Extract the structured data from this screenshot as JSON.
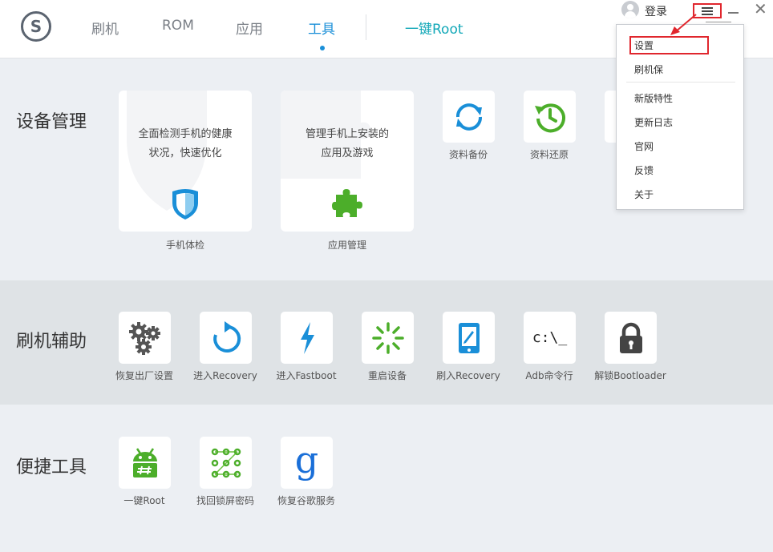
{
  "header": {
    "logo_letter": "S",
    "tabs": [
      {
        "label": "刷机"
      },
      {
        "label": "ROM"
      },
      {
        "label": "应用"
      },
      {
        "label": "工具"
      }
    ],
    "active_tab": "工具",
    "root_link": "一键Root",
    "login": "登录",
    "close_glyph": "✕"
  },
  "device_management": {
    "title": "设备管理",
    "health_card": {
      "line1": "全面检测手机的健康",
      "line2": "状况，快速优化",
      "label": "手机体检"
    },
    "app_card": {
      "line1": "管理手机上安装的",
      "line2": "应用及游戏",
      "label": "应用管理"
    },
    "tiles": [
      {
        "label": "资料备份",
        "icon": "sync-icon"
      },
      {
        "label": "资料还原",
        "icon": "clock-restore-icon"
      }
    ]
  },
  "flash_assist": {
    "title": "刷机辅助",
    "tiles": [
      {
        "label": "恢复出厂设置",
        "icon": "gears-icon"
      },
      {
        "label": "进入Recovery",
        "icon": "refresh-icon"
      },
      {
        "label": "进入Fastboot",
        "icon": "lightning-icon"
      },
      {
        "label": "重启设备",
        "icon": "spinner-icon"
      },
      {
        "label": "刷入Recovery",
        "icon": "tablet-edit-icon"
      },
      {
        "label": "Adb命令行",
        "icon": "terminal-icon",
        "glyph": "c:\\_"
      },
      {
        "label": "解锁Bootloader",
        "icon": "lock-icon"
      }
    ]
  },
  "quick_tools": {
    "title": "便捷工具",
    "tiles": [
      {
        "label": "一键Root",
        "icon": "android-root-icon"
      },
      {
        "label": "找回锁屏密码",
        "icon": "pattern-lock-icon"
      },
      {
        "label": "恢复谷歌服务",
        "icon": "google-icon",
        "glyph": "g"
      }
    ]
  },
  "dropdown_menu": {
    "items": [
      {
        "label": "设置"
      },
      {
        "label": "刷机保"
      },
      {
        "label": "新版特性"
      },
      {
        "label": "更新日志"
      },
      {
        "label": "官网"
      },
      {
        "label": "反馈"
      },
      {
        "label": "关于"
      }
    ],
    "highlighted": "设置"
  },
  "colors": {
    "accent_blue": "#1a8fd8",
    "root_teal": "#12a8b8",
    "green": "#4cae2a",
    "highlight_red": "#e0262d"
  }
}
